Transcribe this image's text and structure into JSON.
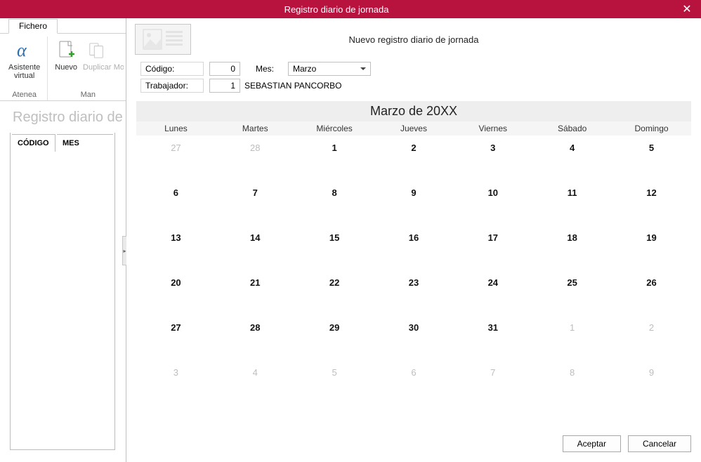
{
  "titlebar": {
    "title": "Registro diario de jornada"
  },
  "ribbon": {
    "tab": "Fichero",
    "group1_label": "Atenea",
    "group2_label": "Man",
    "btn_asistente_l1": "Asistente",
    "btn_asistente_l2": "virtual",
    "btn_nuevo": "Nuevo",
    "btn_duplicar": "Duplicar",
    "btn_m": "Mo"
  },
  "bg": {
    "heading": "Registro diario de",
    "col_codigo": "CÓDIGO",
    "col_mes": "MES"
  },
  "dialog": {
    "title": "Nuevo registro diario de jornada",
    "lbl_codigo": "Código:",
    "val_codigo": "0",
    "lbl_mes": "Mes:",
    "val_mes": "Marzo",
    "lbl_trabajador": "Trabajador:",
    "val_trabajador_num": "1",
    "val_trabajador_name": "SEBASTIAN PANCORBO",
    "cal_title": "Marzo de 20XX",
    "weekdays": [
      "Lunes",
      "Martes",
      "Miércoles",
      "Jueves",
      "Viernes",
      "Sábado",
      "Domingo"
    ],
    "weeks": [
      [
        {
          "n": "27",
          "out": true
        },
        {
          "n": "28",
          "out": true
        },
        {
          "n": "1"
        },
        {
          "n": "2"
        },
        {
          "n": "3"
        },
        {
          "n": "4"
        },
        {
          "n": "5"
        }
      ],
      [
        {
          "n": "6"
        },
        {
          "n": "7"
        },
        {
          "n": "8"
        },
        {
          "n": "9"
        },
        {
          "n": "10"
        },
        {
          "n": "11"
        },
        {
          "n": "12"
        }
      ],
      [
        {
          "n": "13"
        },
        {
          "n": "14"
        },
        {
          "n": "15"
        },
        {
          "n": "16"
        },
        {
          "n": "17"
        },
        {
          "n": "18"
        },
        {
          "n": "19"
        }
      ],
      [
        {
          "n": "20"
        },
        {
          "n": "21"
        },
        {
          "n": "22"
        },
        {
          "n": "23"
        },
        {
          "n": "24"
        },
        {
          "n": "25"
        },
        {
          "n": "26"
        }
      ],
      [
        {
          "n": "27"
        },
        {
          "n": "28"
        },
        {
          "n": "29"
        },
        {
          "n": "30"
        },
        {
          "n": "31"
        },
        {
          "n": "1",
          "out": true
        },
        {
          "n": "2",
          "out": true
        }
      ],
      [
        {
          "n": "3",
          "out": true
        },
        {
          "n": "4",
          "out": true
        },
        {
          "n": "5",
          "out": true
        },
        {
          "n": "6",
          "out": true
        },
        {
          "n": "7",
          "out": true
        },
        {
          "n": "8",
          "out": true
        },
        {
          "n": "9",
          "out": true
        }
      ]
    ],
    "btn_accept": "Aceptar",
    "btn_cancel": "Cancelar"
  }
}
